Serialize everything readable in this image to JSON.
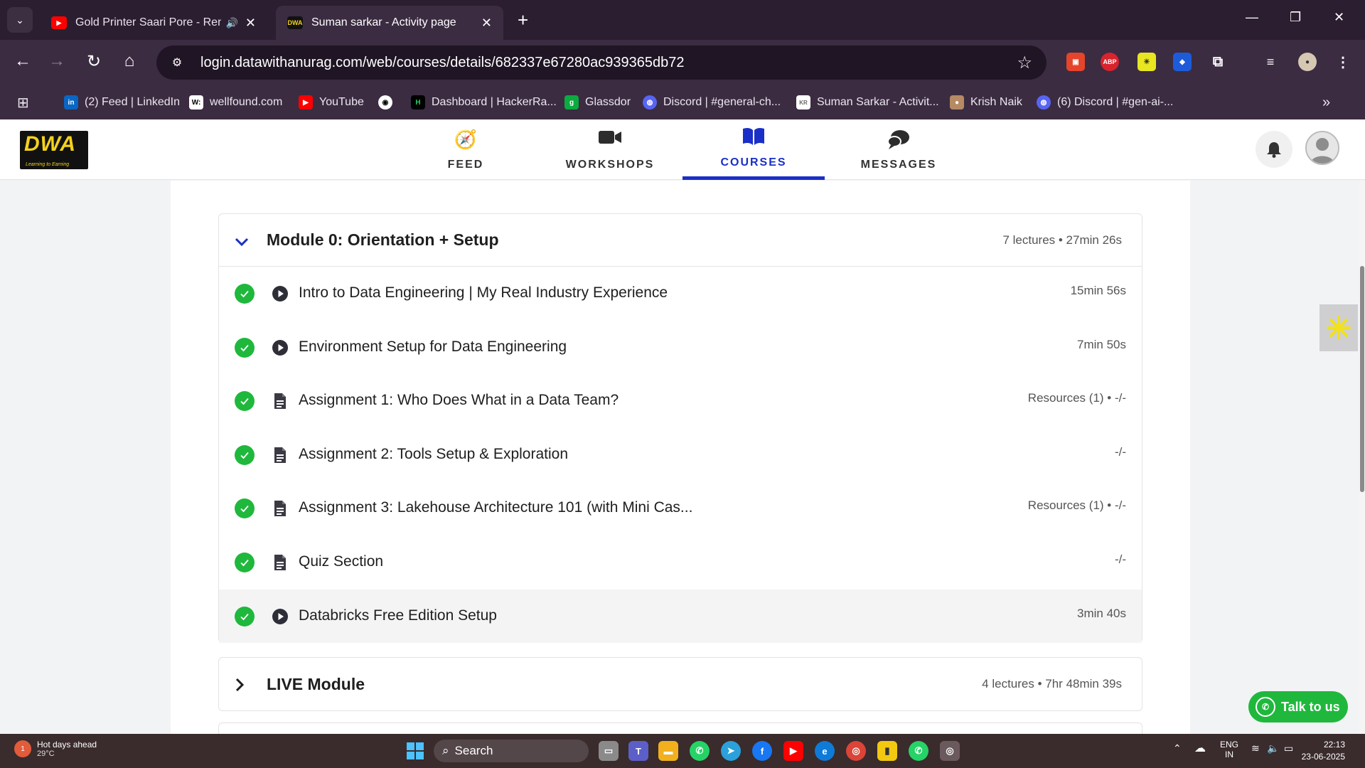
{
  "browser": {
    "tabs": [
      {
        "title": "Gold Printer Saari Pore - Remix",
        "favicon": "youtube-icon",
        "audio": true
      },
      {
        "title": "Suman sarkar - Activity page",
        "favicon": "dwa-icon",
        "active": true
      }
    ],
    "url": "login.datawithanurag.com/web/courses/details/682337e67280ac939365db72",
    "bookmarks": [
      {
        "label": "(2) Feed | LinkedIn",
        "icon": "linkedin-icon"
      },
      {
        "label": "wellfound.com",
        "icon": "wellfound-icon"
      },
      {
        "label": "YouTube",
        "icon": "youtube-icon"
      },
      {
        "label": "",
        "icon": "github-icon"
      },
      {
        "label": "Dashboard | HackerRa...",
        "icon": "hackerrank-icon"
      },
      {
        "label": "Glassdor",
        "icon": "glassdoor-icon"
      },
      {
        "label": "Discord | #general-ch...",
        "icon": "discord-icon"
      },
      {
        "label": "Suman Sarkar - Activit...",
        "icon": "page-icon"
      },
      {
        "label": "Krish Naik",
        "icon": "avatar-icon"
      },
      {
        "label": "(6) Discord | #gen-ai-...",
        "icon": "discord-icon"
      }
    ],
    "extensions": {
      "abp": "ABP"
    }
  },
  "site": {
    "logo_text": "DWA",
    "logo_subtext": "Learning to Earning",
    "nav": [
      {
        "label": "FEED",
        "icon": "compass-icon"
      },
      {
        "label": "WORKSHOPS",
        "icon": "video-camera-icon"
      },
      {
        "label": "COURSES",
        "icon": "open-book-icon",
        "active": true
      },
      {
        "label": "MESSAGES",
        "icon": "chat-bubbles-icon"
      }
    ]
  },
  "modules": [
    {
      "title": "Module 0: Orientation + Setup",
      "meta": "7 lectures • 27min 26s",
      "expanded": true,
      "lectures": [
        {
          "title": "Intro to Data Engineering | My Real Industry Experience",
          "meta": "15min 56s",
          "type": "video",
          "completed": true
        },
        {
          "title": "Environment Setup for Data Engineering",
          "meta": "7min 50s",
          "type": "video",
          "completed": true
        },
        {
          "title": "Assignment 1: Who Does What in a Data Team?",
          "meta": "Resources (1) • -/-",
          "type": "document",
          "completed": true
        },
        {
          "title": "Assignment 2: Tools Setup & Exploration",
          "meta": "-/-",
          "type": "document",
          "completed": true
        },
        {
          "title": "Assignment 3: Lakehouse Architecture 101 (with Mini Cas...",
          "meta": "Resources (1) • -/-",
          "type": "document",
          "completed": true
        },
        {
          "title": "Quiz Section",
          "meta": "-/-",
          "type": "document",
          "completed": true
        },
        {
          "title": "Databricks Free Edition Setup",
          "meta": "3min 40s",
          "type": "video",
          "completed": true
        }
      ]
    },
    {
      "title": "LIVE Module",
      "meta": "4 lectures • 7hr 48min 39s",
      "expanded": false
    }
  ],
  "chat_button": {
    "label": "Talk to us"
  },
  "taskbar": {
    "weather_title": "Hot days ahead",
    "weather_temp": "29°C",
    "weather_badge": "1",
    "search_placeholder": "Search",
    "lang_top": "ENG",
    "lang_bottom": "IN",
    "time": "22:13",
    "date": "23-06-2025"
  },
  "colors": {
    "accent": "#1a2fc7",
    "success": "#1fb83c",
    "chrome_bg": "#3b2c42"
  }
}
